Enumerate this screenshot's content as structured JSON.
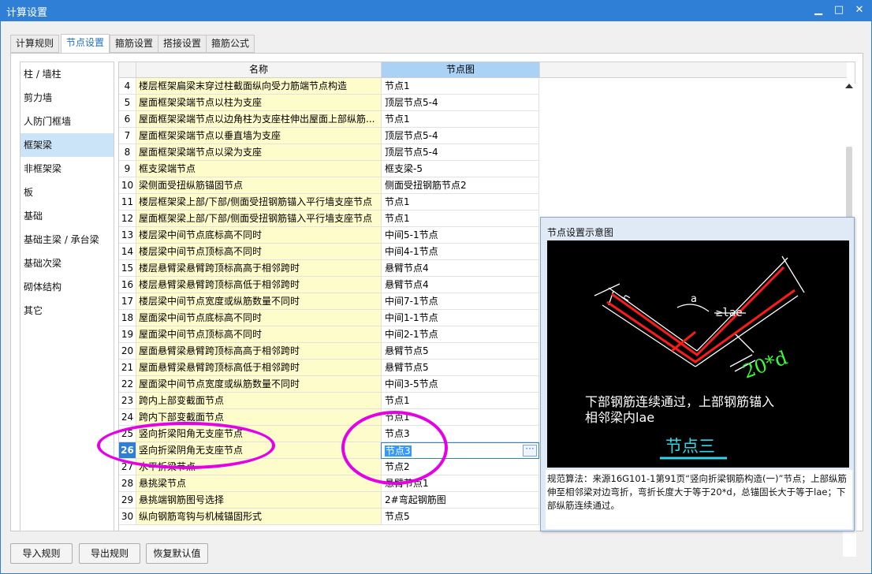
{
  "window": {
    "title": "计算设置",
    "minimize": "▁",
    "maximize": "□",
    "close": "✕"
  },
  "tabs": [
    {
      "label": "计算规则",
      "active": false
    },
    {
      "label": "节点设置",
      "active": true
    },
    {
      "label": "箍筋设置",
      "active": false
    },
    {
      "label": "搭接设置",
      "active": false
    },
    {
      "label": "箍筋公式",
      "active": false
    }
  ],
  "sidebar": {
    "items": [
      {
        "label": "柱 / 墙柱",
        "active": false
      },
      {
        "label": "剪力墙",
        "active": false
      },
      {
        "label": "人防门框墙",
        "active": false
      },
      {
        "label": "框架梁",
        "active": true
      },
      {
        "label": "非框架梁",
        "active": false
      },
      {
        "label": "板",
        "active": false
      },
      {
        "label": "基础",
        "active": false
      },
      {
        "label": "基础主梁 / 承台梁",
        "active": false
      },
      {
        "label": "基础次梁",
        "active": false
      },
      {
        "label": "砌体结构",
        "active": false
      },
      {
        "label": "其它",
        "active": false
      }
    ]
  },
  "grid": {
    "columns": {
      "name": "名称",
      "node": "节点图"
    },
    "rows": [
      {
        "num": "4",
        "name": "楼层框架扁梁末穿过柱截面纵向受力筋端节点构造",
        "node": "节点1"
      },
      {
        "num": "5",
        "name": "屋面框架梁端节点以柱为支座",
        "node": "顶层节点5-4"
      },
      {
        "num": "6",
        "name": "屋面框架梁端节点以边角柱为支座柱伸出屋面上部纵筋...",
        "node": "节点1"
      },
      {
        "num": "7",
        "name": "屋面框架梁端节点以垂直墙为支座",
        "node": "顶层节点5-4"
      },
      {
        "num": "8",
        "name": "屋面框架梁端节点以梁为支座",
        "node": "顶层节点5-4"
      },
      {
        "num": "9",
        "name": "框支梁端节点",
        "node": "框支梁-5"
      },
      {
        "num": "10",
        "name": "梁侧面受扭纵筋锚固节点",
        "node": "侧面受扭钢筋节点2"
      },
      {
        "num": "11",
        "name": "楼层框架梁上部/下部/侧面受扭钢筋锚入平行墙支座节点",
        "node": "节点1"
      },
      {
        "num": "12",
        "name": "屋面框架梁上部/下部/侧面受扭钢筋锚入平行墙支座节点",
        "node": "节点1"
      },
      {
        "num": "13",
        "name": "楼层梁中间节点底标高不同时",
        "node": "中间5-1节点"
      },
      {
        "num": "14",
        "name": "楼层梁中间节点顶标高不同时",
        "node": "中间4-1节点"
      },
      {
        "num": "15",
        "name": "楼层悬臂梁悬臂跨顶标高高于相邻跨时",
        "node": "悬臂节点4"
      },
      {
        "num": "16",
        "name": "楼层悬臂梁悬臂跨顶标高低于相邻跨时",
        "node": "悬臂节点4"
      },
      {
        "num": "17",
        "name": "楼层梁中间节点宽度或纵筋数量不同时",
        "node": "中间7-1节点"
      },
      {
        "num": "18",
        "name": "屋面梁中间节点底标高不同时",
        "node": "中间1-1节点"
      },
      {
        "num": "19",
        "name": "屋面梁中间节点顶标高不同时",
        "node": "中间2-1节点"
      },
      {
        "num": "20",
        "name": "屋面悬臂梁悬臂跨顶标高高于相邻跨时",
        "node": "悬臂节点5"
      },
      {
        "num": "21",
        "name": "屋面悬臂梁悬臂跨顶标高低于相邻跨时",
        "node": "悬臂节点5"
      },
      {
        "num": "22",
        "name": "屋面梁中间节点宽度或纵筋数量不同时",
        "node": "中间3-5节点"
      },
      {
        "num": "23",
        "name": "跨内上部变截面节点",
        "node": "节点1"
      },
      {
        "num": "24",
        "name": "跨内下部变截面节点",
        "node": "节点1"
      },
      {
        "num": "25",
        "name": "竖向折梁阳角无支座节点",
        "node": "节点3"
      },
      {
        "num": "26",
        "name": "竖向折梁阴角无支座节点",
        "node": "节点3",
        "selected": true
      },
      {
        "num": "27",
        "name": "水平折梁节点",
        "node": "节点2"
      },
      {
        "num": "28",
        "name": "悬挑梁节点",
        "node": "悬臂节点1"
      },
      {
        "num": "29",
        "name": "悬挑端钢筋图号选择",
        "node": "2#弯起钢筋图"
      },
      {
        "num": "30",
        "name": "纵向钢筋弯钩与机械锚固形式",
        "node": "节点5"
      }
    ],
    "ellipsis": "···"
  },
  "popup": {
    "title": "节点设置示意图",
    "diagram": {
      "label_a": "a",
      "label_h": "h",
      "label_lae": "≥lae",
      "label_20d": "20*d",
      "caption_line1": "下部钢筋连续通过，上部钢筋锚入",
      "caption_line2": "相邻梁内lae",
      "node_title": "节点三",
      "colors": {
        "rebar": "#ff1a1a",
        "outline": "#ffffff",
        "dimension": "#33ff33",
        "node_title": "#2ed8e6"
      }
    },
    "description": "规范算法：来源16G101-1第91页“竖向折梁钢筋构造(一)”节点；上部纵筋伸至相邻梁对边弯折，弯折长度大于等于20*d，总锚固长大于等于lae；下部纵筋连续通过。"
  },
  "buttons": {
    "import": "导入规则",
    "export": "导出规则",
    "restore": "恢复默认值"
  },
  "annotation_color": "#e600e6"
}
